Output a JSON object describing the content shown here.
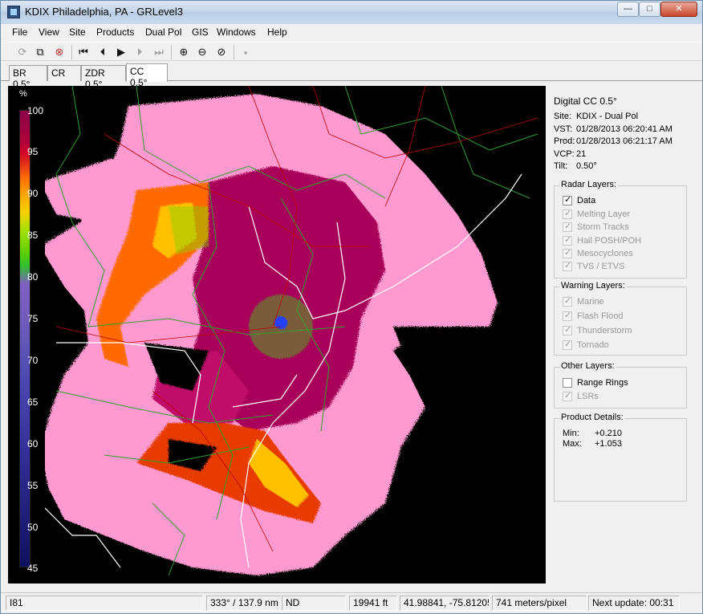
{
  "window": {
    "title": "KDIX Philadelphia, PA - GRLevel3",
    "minimize_glyph": "—",
    "maximize_glyph": "□",
    "close_glyph": "✕"
  },
  "menu": [
    "File",
    "View",
    "Site",
    "Products",
    "Dual Pol",
    "GIS",
    "Windows",
    "Help"
  ],
  "toolbar": {
    "icons": [
      "refresh-icon",
      "copy-icon",
      "stop-loop-icon",
      "first-frame-icon",
      "prev-frame-icon",
      "play-icon",
      "next-frame-icon",
      "last-frame-icon",
      "zoom-in-icon",
      "zoom-out-icon",
      "zoom-reset-icon",
      "clear-icon"
    ],
    "glyphs": {
      "refresh": "⟳",
      "copy": "⧉",
      "stop_loop": "⊗",
      "first": "⏮",
      "prev": "⏴",
      "play": "▶",
      "next": "⏵",
      "last": "⏭",
      "zoom_in": "⊕",
      "zoom_out": "⊖",
      "zoom_reset": "⊘",
      "clear": "▪"
    }
  },
  "tabs": [
    {
      "label": "BR 0.5°",
      "active": false
    },
    {
      "label": "CR",
      "active": false
    },
    {
      "label": "ZDR 0.5°",
      "active": false
    },
    {
      "label": "CC 0.5°",
      "active": true
    }
  ],
  "legend": {
    "unit": "%",
    "ticks": [
      "100",
      "95",
      "90",
      "85",
      "80",
      "75",
      "70",
      "65",
      "60",
      "55",
      "50",
      "45"
    ]
  },
  "info": {
    "product": "Digital CC 0.5°",
    "site_label": "Site:",
    "site_value": "KDIX - Dual Pol",
    "vst_label": "VST:",
    "vst_value": "01/28/2013  06:20:41 AM",
    "prod_label": "Prod:",
    "prod_value": "01/28/2013  06:21:17 AM",
    "vcp_label": "VCP:",
    "vcp_value": "21",
    "tilt_label": "Tilt:",
    "tilt_value": "0.50°"
  },
  "radar_layers": {
    "title": "Radar Layers:",
    "items": [
      {
        "label": "Data",
        "checked": true,
        "enabled": true
      },
      {
        "label": "Melting Layer",
        "checked": true,
        "enabled": false
      },
      {
        "label": "Storm Tracks",
        "checked": true,
        "enabled": false
      },
      {
        "label": "Hail POSH/POH",
        "checked": true,
        "enabled": false
      },
      {
        "label": "Mesocyclones",
        "checked": true,
        "enabled": false
      },
      {
        "label": "TVS / ETVS",
        "checked": true,
        "enabled": false
      }
    ]
  },
  "warning_layers": {
    "title": "Warning Layers:",
    "items": [
      {
        "label": "Marine",
        "checked": true,
        "enabled": false
      },
      {
        "label": "Flash Flood",
        "checked": true,
        "enabled": false
      },
      {
        "label": "Thunderstorm",
        "checked": true,
        "enabled": false
      },
      {
        "label": "Tornado",
        "checked": true,
        "enabled": false
      }
    ]
  },
  "other_layers": {
    "title": "Other Layers:",
    "items": [
      {
        "label": "Range Rings",
        "checked": false,
        "enabled": true
      },
      {
        "label": "LSRs",
        "checked": true,
        "enabled": false
      }
    ]
  },
  "product_details": {
    "title": "Product Details:",
    "min_label": "Min:",
    "min_value": "+0.210",
    "max_label": "Max:",
    "max_value": "+1.053"
  },
  "status": {
    "cell1": "I81",
    "bearing_range": "333° / 137.9 nm",
    "value": "ND",
    "height": "19941 ft",
    "coords": "41.98841, -75.81205",
    "resolution": "741 meters/pixel",
    "next_update": "Next update: 00:31"
  },
  "colors": {
    "radar_bg": "#000000",
    "cc_high": "#8b0048",
    "cc_pink": "#ff9ad0",
    "cc_orange": "#ff7000",
    "cc_yellow": "#ffd000",
    "county_lines": "#2fa02f",
    "state_lines": "#ffffff",
    "roads": "#c00000"
  }
}
